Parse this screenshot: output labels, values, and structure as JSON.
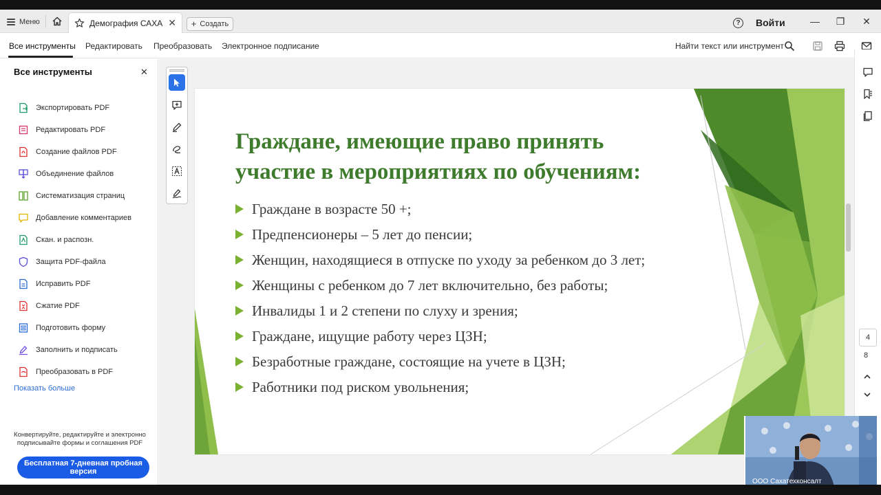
{
  "titlebar": {
    "menu_label": "Меню",
    "tab_title": "Демография САХА...",
    "tab_close": "✕",
    "create_label": "Создать",
    "help_glyph": "?",
    "signin_label": "Войти",
    "minimize_glyph": "—",
    "restore_glyph": "❐",
    "close_glyph": "✕"
  },
  "menu": {
    "items": [
      "Все инструменты",
      "Редактировать",
      "Преобразовать",
      "Электронное подписание"
    ],
    "find_label": "Найти текст или инструмент"
  },
  "left_panel": {
    "title": "Все инструменты",
    "close_glyph": "✕",
    "items": [
      {
        "label": "Экспортировать PDF",
        "icon": "export-pdf-icon",
        "color": "#1f9a6a"
      },
      {
        "label": "Редактировать PDF",
        "icon": "edit-pdf-icon",
        "color": "#d6336c"
      },
      {
        "label": "Создание файлов PDF",
        "icon": "create-pdf-icon",
        "color": "#e03131"
      },
      {
        "label": "Объединение файлов",
        "icon": "combine-files-icon",
        "color": "#5b4fd6"
      },
      {
        "label": "Систематизация страниц",
        "icon": "organize-pages-icon",
        "color": "#5aa02c"
      },
      {
        "label": "Добавление комментариев",
        "icon": "comment-icon",
        "color": "#e2b400"
      },
      {
        "label": "Скан. и распозн.",
        "icon": "scan-icon",
        "color": "#1f9a6a"
      },
      {
        "label": "Защита PDF-файла",
        "icon": "protect-icon",
        "color": "#5b4fd6"
      },
      {
        "label": "Исправить PDF",
        "icon": "fix-pdf-icon",
        "color": "#2b6bd6"
      },
      {
        "label": "Сжатие PDF",
        "icon": "compress-icon",
        "color": "#e03131"
      },
      {
        "label": "Подготовить форму",
        "icon": "prepare-form-icon",
        "color": "#2b6bd6"
      },
      {
        "label": "Заполнить и подписать",
        "icon": "fill-sign-icon",
        "color": "#7048e8"
      },
      {
        "label": "Преобразовать в PDF",
        "icon": "convert-pdf-icon",
        "color": "#e03131"
      }
    ],
    "show_more": "Показать больше",
    "promo_text": "Конвертируйте, редактируйте и электронно подписывайте формы и соглашения PDF",
    "trial_button": "Бесплатная 7-дневная пробная версия"
  },
  "slide": {
    "title_line1": "Граждане, имеющие право принять",
    "title_line2": "участие в мероприятиях по обучениям:",
    "bullets": [
      "Граждане в возрасте 50 +;",
      "Предпенсионеры – 5 лет до пенсии;",
      "Женщин, находящиеся в отпуске по уходу за ребенком до 3 лет;",
      "Женщины с ребенком до 7 лет включительно, без работы;",
      "Инвалиды 1 и 2 степени по слуху и зрения;",
      "Граждане, ищущие работу через ЦЗН;",
      "Безработные граждане, состоящие на учете в ЦЗН;",
      "Работники под риском увольнения;"
    ],
    "title_color": "#3e7b2c",
    "bullet_color": "#7bb130"
  },
  "navigation": {
    "current_page": "4",
    "total_pages": "8"
  },
  "webcam": {
    "label": "ООО Сахатехконсалт"
  },
  "colors": {
    "accent": "#1a5ce6",
    "selected_tool": "#2b72e8"
  }
}
